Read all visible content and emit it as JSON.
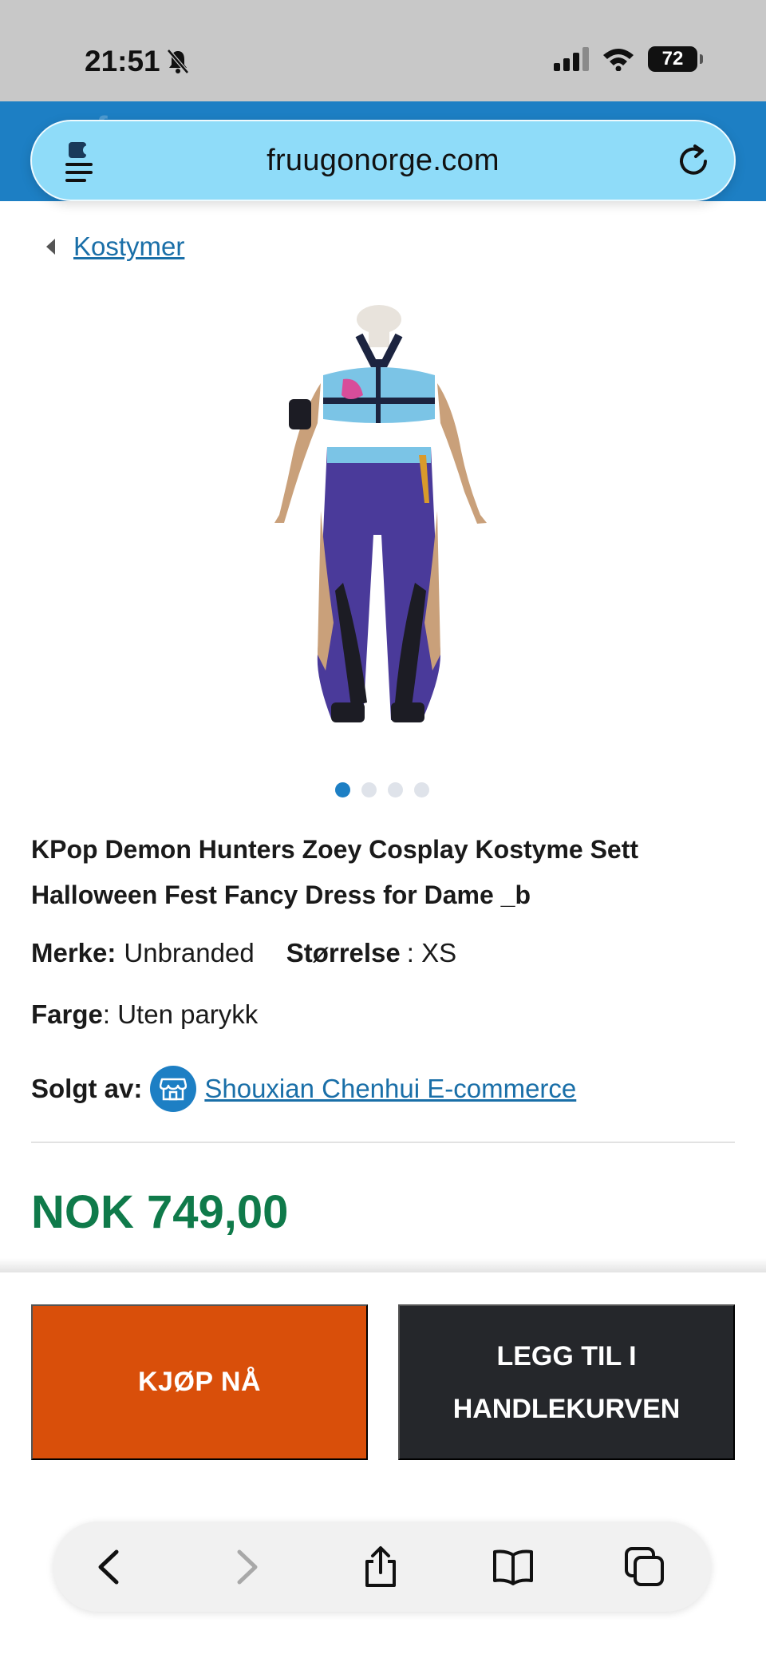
{
  "status_bar": {
    "time": "21:51",
    "battery": "72"
  },
  "browser": {
    "url": "fruugonorge.com"
  },
  "header": {
    "pattern_text": "fruugo"
  },
  "breadcrumb": {
    "label": "Kostymer"
  },
  "product": {
    "title": "KPop Demon Hunters Zoey Cosplay Kostyme Sett Halloween Fest Fancy Dress for Dame _b",
    "brand_label": "Merke:",
    "brand_value": "Unbranded",
    "size_label": "Størrelse",
    "size_value": ": XS",
    "color_label": "Farge",
    "color_value": ": Uten parykk",
    "seller_label": "Solgt av:",
    "seller_name": "Shouxian Chenhui E-commerce",
    "price": "NOK 749,00",
    "image_count": 4,
    "active_image": 1
  },
  "actions": {
    "buy_now": "KJØP NÅ",
    "add_to_cart": "LEGG TIL I HANDLEKURVEN"
  },
  "colors": {
    "brand_blue": "#1d7fc4",
    "price_green": "#0f7a4a",
    "buy_orange": "#d94f0a",
    "cart_dark": "#25272b"
  },
  "toolbar_icons": [
    "back-icon",
    "forward-icon",
    "share-icon",
    "bookmarks-icon",
    "tabs-icon"
  ]
}
